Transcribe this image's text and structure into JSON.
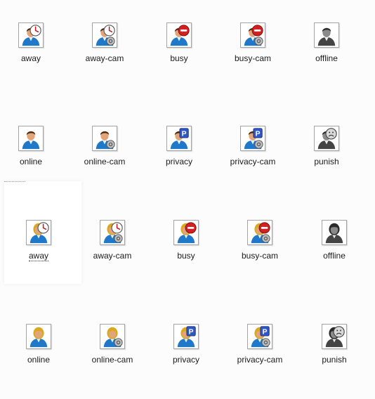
{
  "folder": {
    "rows": [
      {
        "person": "male",
        "items": [
          {
            "label": "away",
            "status": "away"
          },
          {
            "label": "away-cam",
            "status": "away",
            "cam": true
          },
          {
            "label": "busy",
            "status": "busy"
          },
          {
            "label": "busy-cam",
            "status": "busy",
            "cam": true
          },
          {
            "label": "offline",
            "status": "offline"
          }
        ]
      },
      {
        "person": "male",
        "items": [
          {
            "label": "online",
            "status": "online"
          },
          {
            "label": "online-cam",
            "status": "online",
            "cam": true
          },
          {
            "label": "privacy",
            "status": "privacy"
          },
          {
            "label": "privacy-cam",
            "status": "privacy",
            "cam": true
          },
          {
            "label": "punish",
            "status": "punish"
          }
        ]
      },
      {
        "person": "female",
        "items": [
          {
            "label": "away",
            "status": "away",
            "focused": true
          },
          {
            "label": "away-cam",
            "status": "away",
            "cam": true
          },
          {
            "label": "busy",
            "status": "busy"
          },
          {
            "label": "busy-cam",
            "status": "busy",
            "cam": true
          },
          {
            "label": "offline",
            "status": "offline"
          }
        ]
      },
      {
        "person": "female",
        "items": [
          {
            "label": "online",
            "status": "online"
          },
          {
            "label": "online-cam",
            "status": "online",
            "cam": true
          },
          {
            "label": "privacy",
            "status": "privacy"
          },
          {
            "label": "privacy-cam",
            "status": "privacy",
            "cam": true
          },
          {
            "label": "punish",
            "status": "punish"
          }
        ]
      }
    ]
  },
  "colors": {
    "shirt": "#1f78c8",
    "skin": "#e2a57a",
    "male_hair": "#4a2a12",
    "female_hair": "#d9a81f",
    "gray_dark": "#444444",
    "gray_mid": "#8a8a8a",
    "busy_red": "#d42020",
    "privacy_blue": "#2f57c8",
    "clock_red": "#c01818"
  }
}
